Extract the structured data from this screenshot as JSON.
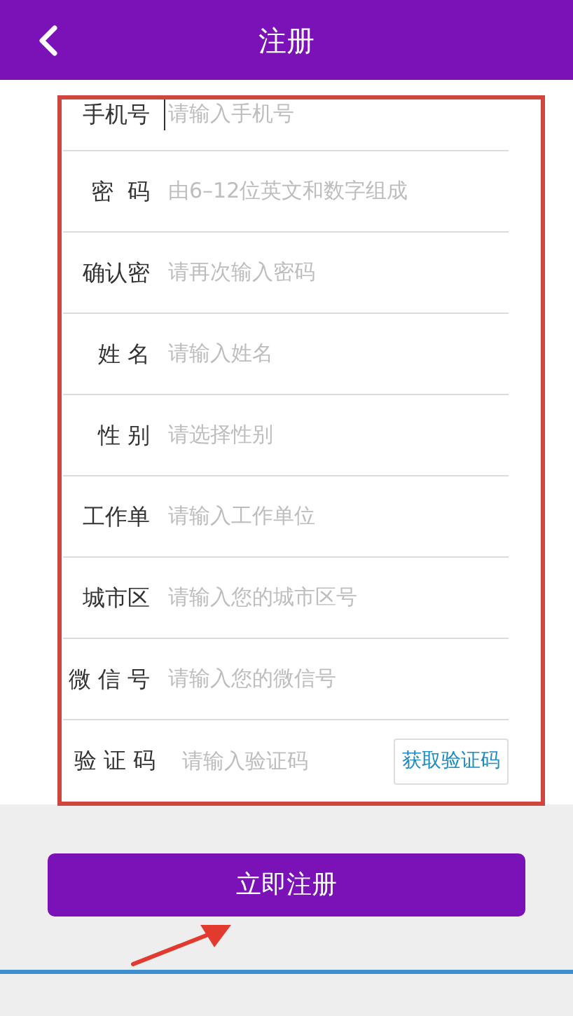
{
  "header": {
    "title": "注册"
  },
  "fields": [
    {
      "kind": "text",
      "label": "手机号",
      "placeholder": "请输入手机号",
      "focused": true
    },
    {
      "kind": "text",
      "label": "密  码",
      "placeholder": "由6–12位英文和数字组成",
      "focused": false
    },
    {
      "kind": "text",
      "label": "确认密",
      "placeholder": "请再次输入密码",
      "focused": false
    },
    {
      "kind": "text",
      "label": "姓 名",
      "placeholder": "请输入姓名",
      "focused": false
    },
    {
      "kind": "text",
      "label": "性 别",
      "placeholder": "请选择性别",
      "focused": false
    },
    {
      "kind": "text",
      "label": "工作单",
      "placeholder": "请输入工作单位",
      "focused": false
    },
    {
      "kind": "text",
      "label": "城市区",
      "placeholder": "请输入您的城市区号",
      "focused": false
    },
    {
      "kind": "text",
      "label": "微 信 号",
      "placeholder": "请输入您的微信号",
      "focused": false
    },
    {
      "kind": "code",
      "label": "验 证 码",
      "placeholder": "请输入验证码",
      "focused": false,
      "button": "获取验证码"
    }
  ],
  "submit": "立即注册"
}
